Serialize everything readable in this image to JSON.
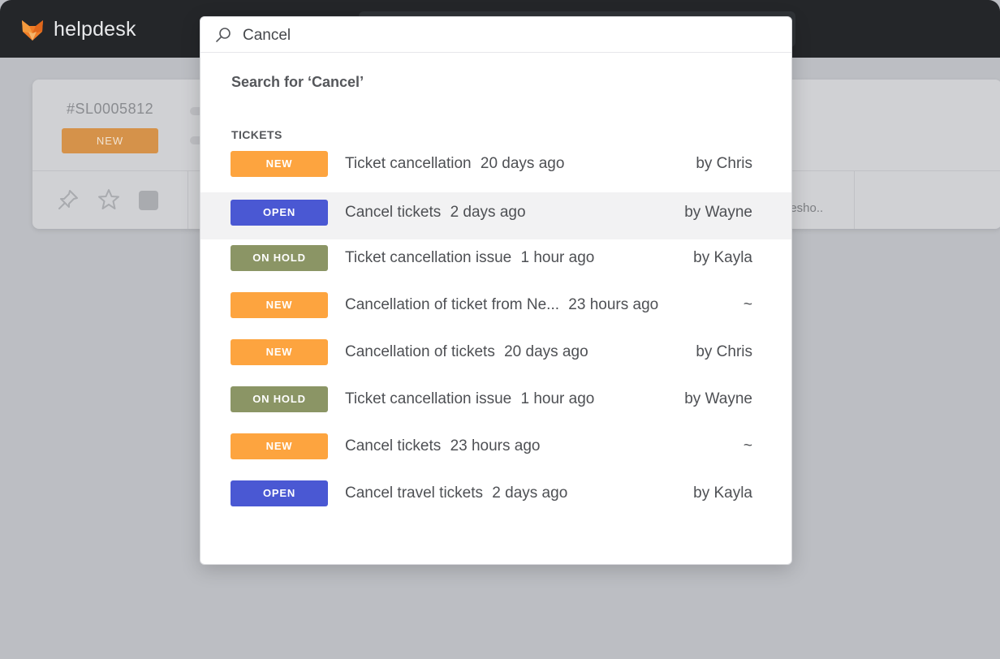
{
  "app": {
    "name": "helpdesk"
  },
  "background_ticket": {
    "id": "#SL0005812",
    "status": "NEW",
    "snippet": "lesho.."
  },
  "search": {
    "query": "Cancel",
    "search_for_label": "Search for ‘Cancel’",
    "section_label": "TICKETS"
  },
  "status_colors": {
    "NEW": "#fda43f",
    "OPEN": "#4a58d3",
    "ON HOLD": "#8b9565"
  },
  "results": [
    {
      "status": "NEW",
      "color": "#fda43f",
      "title": "Ticket cancellation",
      "time": "20 days ago",
      "author": "by Chris"
    },
    {
      "status": "OPEN",
      "color": "#4a58d3",
      "title": "Cancel tickets",
      "time": "2 days ago",
      "author": "by Wayne",
      "highlighted": true
    },
    {
      "status": "ON HOLD",
      "color": "#8b9565",
      "title": "Ticket cancellation issue",
      "time": "1 hour ago",
      "author": "by Kayla"
    },
    {
      "status": "NEW",
      "color": "#fda43f",
      "title": "Cancellation of ticket from Ne...",
      "time": "23 hours ago",
      "author": "~"
    },
    {
      "status": "NEW",
      "color": "#fda43f",
      "title": "Cancellation of tickets",
      "time": "20 days ago",
      "author": "by Chris"
    },
    {
      "status": "ON HOLD",
      "color": "#8b9565",
      "title": "Ticket cancellation issue",
      "time": "1 hour ago",
      "author": "by Wayne"
    },
    {
      "status": "NEW",
      "color": "#fda43f",
      "title": "Cancel tickets",
      "time": "23 hours ago",
      "author": "~"
    },
    {
      "status": "OPEN",
      "color": "#4a58d3",
      "title": "Cancel travel tickets",
      "time": "2 days ago",
      "author": "by Kayla"
    }
  ]
}
